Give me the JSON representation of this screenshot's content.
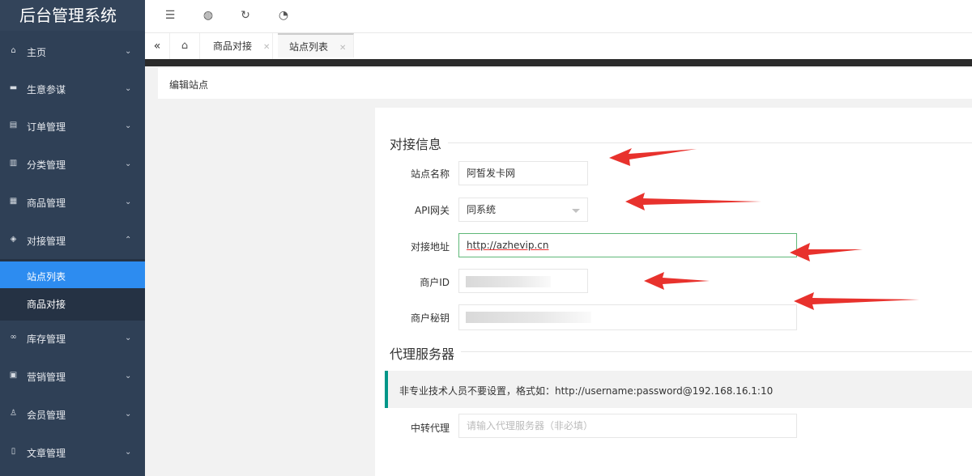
{
  "app": {
    "title": "后台管理系统"
  },
  "sidebar": {
    "items": [
      {
        "label": "主页",
        "icon": "home-icon"
      },
      {
        "label": "生意参谋",
        "icon": "chat-icon"
      },
      {
        "label": "订单管理",
        "icon": "order-icon"
      },
      {
        "label": "分类管理",
        "icon": "category-icon"
      },
      {
        "label": "商品管理",
        "icon": "goods-icon"
      },
      {
        "label": "对接管理",
        "icon": "shield-icon"
      },
      {
        "label": "库存管理",
        "icon": "link-icon"
      },
      {
        "label": "营销管理",
        "icon": "gift-icon"
      },
      {
        "label": "会员管理",
        "icon": "user-icon"
      },
      {
        "label": "文章管理",
        "icon": "article-icon"
      }
    ],
    "sub_items": [
      {
        "label": "站点列表"
      },
      {
        "label": "商品对接"
      }
    ]
  },
  "topbar": {
    "icons": [
      "menu-fold-icon",
      "globe-icon",
      "refresh-icon",
      "dashboard-icon"
    ]
  },
  "tabs": [
    {
      "label": "商品对接"
    },
    {
      "label": "站点列表"
    }
  ],
  "page": {
    "title": "编辑站点"
  },
  "form": {
    "section1": "对接信息",
    "site_name": {
      "label": "站点名称",
      "value": "阿皙发卡网"
    },
    "api_gateway": {
      "label": "API网关",
      "value": "同系统"
    },
    "api_address": {
      "label": "对接地址",
      "value": "http://azhevip.cn"
    },
    "merchant_id": {
      "label": "商户ID",
      "value": ""
    },
    "merchant_key": {
      "label": "商户秘钥",
      "value": ""
    },
    "section2": "代理服务器",
    "tip": "非专业技术人员不要设置，格式如：http://username:password@192.168.16.1:10",
    "proxy": {
      "label": "中转代理",
      "placeholder": "请输入代理服务器（非必填）"
    }
  },
  "colors": {
    "sidebar": "#2f4056",
    "active": "#2d8cf0",
    "focus": "#5fb878",
    "arrow": "#e8322d"
  }
}
